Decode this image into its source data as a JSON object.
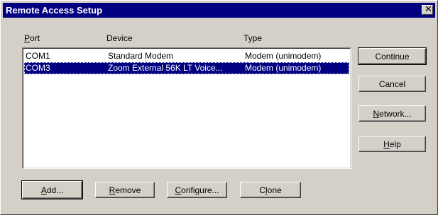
{
  "dialog": {
    "title": "Remote Access Setup",
    "close_glyph": "✕"
  },
  "columns": {
    "port_mnemonic": "P",
    "port_rest": "ort",
    "device": "Device",
    "type": "Type"
  },
  "rows": [
    {
      "port": "COM1",
      "device": "Standard Modem",
      "type": "Modem (unimodem)",
      "selected": false
    },
    {
      "port": "COM3",
      "device": "Zoom External 56K LT Voice...",
      "type": "Modem (unimodem)",
      "selected": true
    }
  ],
  "side_buttons": {
    "continue": "Continue",
    "cancel": "Cancel",
    "network_mnemonic": "N",
    "network_rest": "etwork...",
    "help_mnemonic": "H",
    "help_rest": "elp"
  },
  "bottom_buttons": {
    "add_mnemonic": "A",
    "add_rest": "dd...",
    "remove_mnemonic": "R",
    "remove_rest": "emove",
    "configure_mnemonic": "C",
    "configure_rest": "onfigure...",
    "clone_first": "C",
    "clone_mnemonic": "l",
    "clone_rest": "one"
  },
  "colors": {
    "titlebar": "#000080",
    "face": "#d4d0c8",
    "selection": "#000080"
  }
}
